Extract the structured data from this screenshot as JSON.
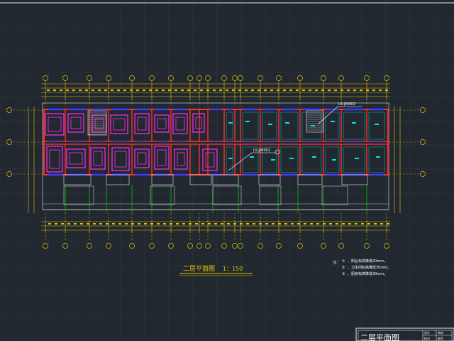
{
  "drawing": {
    "caption": "二层平面图",
    "scale": "1：150",
    "annotations": [
      {
        "id": "a1",
        "text": "LS-JW002"
      },
      {
        "id": "a2",
        "text": "LS-JW002"
      }
    ],
    "notes": {
      "heading": "注：",
      "items": [
        {
          "marker": "①",
          "text": "、阳台标高降低20mm。"
        },
        {
          "marker": "②",
          "text": "、卫生间标高降低30mm。"
        },
        {
          "marker": "③",
          "text": "、厨房标高降低30mm。"
        }
      ]
    },
    "title_block": {
      "sheet_title": "二层平面图",
      "cells": [
        "设计",
        "校对",
        "审核",
        "图号"
      ]
    }
  },
  "colors": {
    "background": "#212830",
    "grid": "#2e3842",
    "axis": "#e6c200",
    "wall": "#ff2d2d",
    "window": "#3b3bff",
    "furniture": "#ff2df0",
    "fixture": "#00e6e6",
    "outline": "#e8e8e8",
    "balcony": "#00c800"
  },
  "icons": [
    "axis-bubble-icon",
    "stair-icon",
    "door-swing-icon",
    "section-mark-icon"
  ]
}
